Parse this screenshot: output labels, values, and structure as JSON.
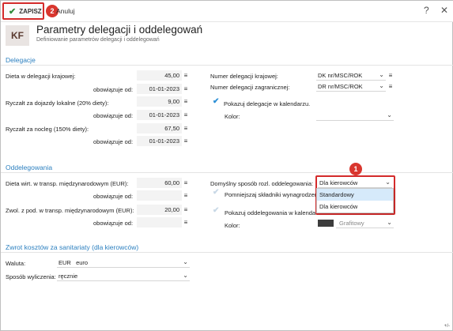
{
  "toolbar": {
    "save_label": "ZAPISZ",
    "cancel_label": "Anuluj",
    "help_icon": "?",
    "close_icon": "✕",
    "badge_save": "2"
  },
  "header": {
    "logo": "KF",
    "title": "Parametry delegacji i oddelegowań",
    "subtitle": "Definiowanie parametrów delegacji i oddelegowań"
  },
  "delegacje": {
    "section_title": "Delegacje",
    "dieta_label": "Dieta w delegacji krajowej:",
    "dieta_value": "45,00",
    "obow_label": "obowiązuje od:",
    "dieta_date": "01-01-2023",
    "ryczalt_lok_label": "Ryczałt za dojazdy lokalne (20% diety):",
    "ryczalt_lok_value": "9,00",
    "ryczalt_lok_date": "01-01-2023",
    "ryczalt_noc_label": "Ryczałt za nocleg (150% diety):",
    "ryczalt_noc_value": "67,50",
    "ryczalt_noc_date": "01-01-2023",
    "nr_kraj_label": "Numer delegacji krajowej:",
    "nr_kraj_value": "DK nr/MSC/ROK",
    "nr_zagr_label": "Numer delegacji zagranicznej:",
    "nr_zagr_value": "DR nr/MSC/ROK",
    "pokazuj_label": "Pokazuj delegacje w kalendarzu.",
    "kolor_label": "Kolor:",
    "kolor_value": ""
  },
  "oddelegowania": {
    "section_title": "Oddelegowania",
    "dieta_label": "Dieta wirt. w transp. międzynarodowym (EUR):",
    "dieta_value": "60,00",
    "obow_label": "obowiązuje od:",
    "dieta_date": "",
    "zwol_label": "Zwol. z pod. w transp. międzynarodowym (EUR):",
    "zwol_value": "20,00",
    "zwol_date": "",
    "sposob_label": "Domyślny sposób rozl. oddelegowania:",
    "sposob_value": "Dla kierowców",
    "pomniejszaj_label": "Pomniejszaj składniki wynagrodzeń",
    "pokazuj_label": "Pokazuj oddelegowania w kalendarzu.",
    "kolor_label": "Kolor:",
    "kolor_value": "Grafitowy",
    "kolor_hex": "#3c3c3c",
    "dropdown_options": [
      "Standardowy",
      "Dla kierowców"
    ],
    "badge": "1"
  },
  "sanitariaty": {
    "section_title": "Zwrot kosztów za sanitariaty (dla kierowców)",
    "waluta_label": "Waluta:",
    "waluta_value": "EUR   euro",
    "sposob_label": "Sposób wyliczenia:",
    "sposob_value": "ręcznie"
  },
  "corner_text": "+/-",
  "colors": {
    "accent": "#2b7fbf",
    "highlight_red": "#d42b2b",
    "check_green": "#2e8b3a"
  }
}
